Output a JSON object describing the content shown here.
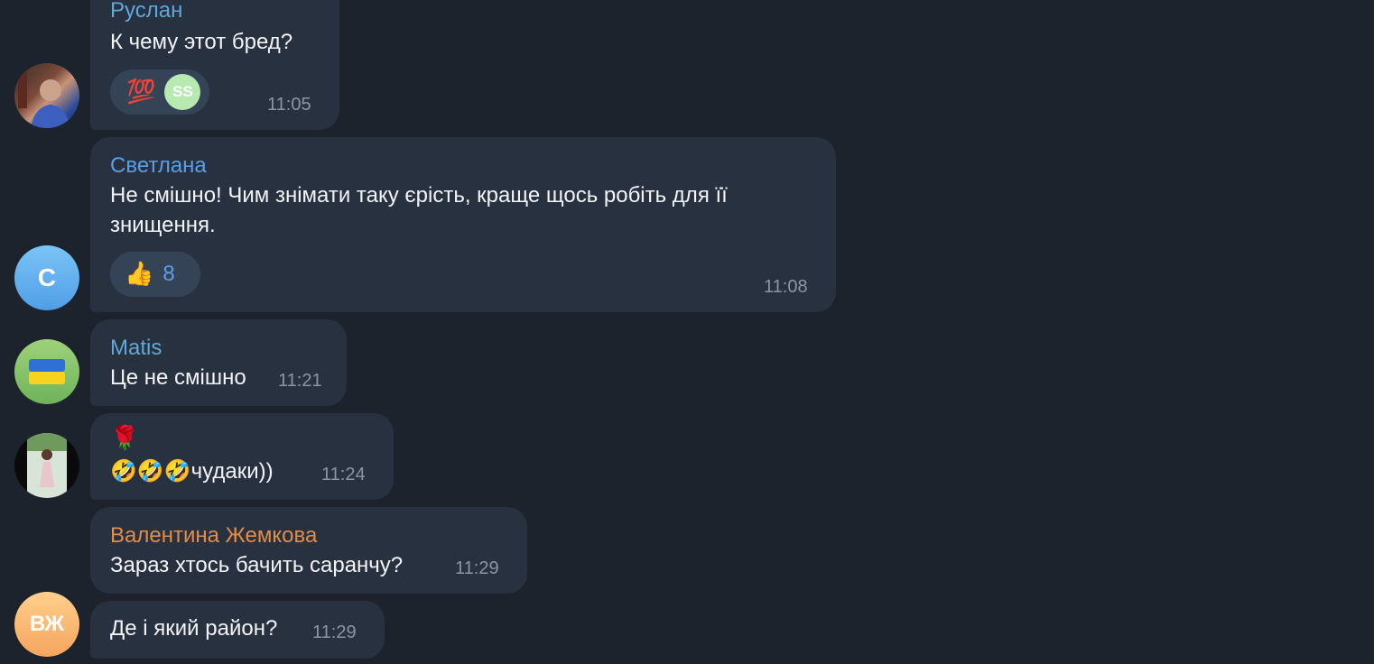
{
  "messages": [
    {
      "sender": "Руслан",
      "text": "К чему этот бред?",
      "time": "11:05",
      "reaction_emoji": "💯",
      "reactor_initials": "SS"
    },
    {
      "sender": "Светлана",
      "text_line1": "Не смішно! Чим знімати таку єрість, краще щось робіть для її",
      "text_line2": "знищення.",
      "time": "11:08",
      "reaction_emoji": "👍",
      "reaction_count": "8",
      "avatar_letter": "С"
    },
    {
      "sender": "Matis",
      "text": "Це не смішно",
      "time": "11:21",
      "avatar_flag": "ukraine-flag"
    },
    {
      "line1": "🌹",
      "line2": "🤣🤣🤣чудаки))",
      "time": "11:24"
    },
    {
      "sender": "Валентина Жемкова",
      "text": "Зараз хтось бачить саранчу?",
      "time": "11:29"
    },
    {
      "text": "Де і який район?",
      "time": "11:29",
      "avatar_initials": "ВЖ"
    }
  ],
  "colors": {
    "background": "#1c232d",
    "bubble": "#27313f",
    "sender_ruslan": "#5fa8d8",
    "sender_svetlana": "#5b9ee6",
    "sender_matis": "#5fa8d8",
    "sender_valentina": "#e38c47",
    "time": "#8b96a3"
  }
}
